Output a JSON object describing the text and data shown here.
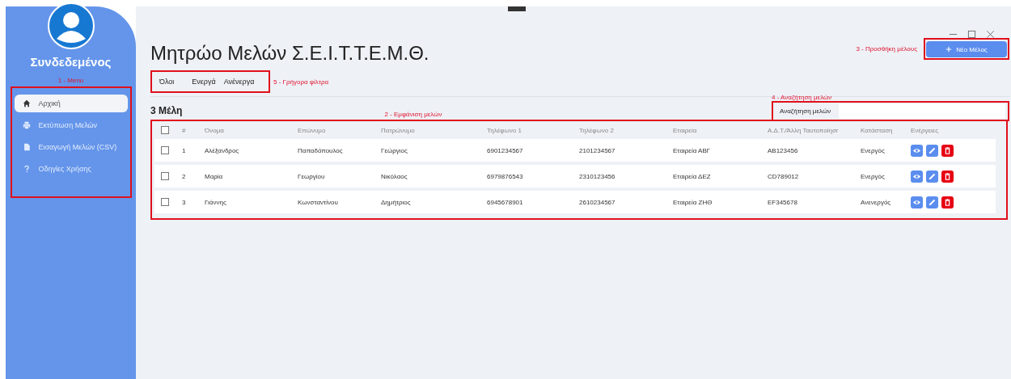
{
  "sidebar": {
    "user": "Συνδεδεμένος",
    "annotation": "1 - Menu",
    "items": [
      {
        "label": "Αρχική",
        "kind": "home",
        "selected": true
      },
      {
        "label": "Εκτύπωση Μελών",
        "kind": "print",
        "selected": false
      },
      {
        "label": "Εισαγωγή Μελών (CSV)",
        "kind": "import",
        "selected": false
      },
      {
        "label": "Οδηγίες Χρήσης",
        "kind": "help",
        "selected": false
      }
    ]
  },
  "title": "Μητρώο Μελών Σ.Ε.Ι.Τ.Τ.Ε.Μ.Θ.",
  "add_button": {
    "label": "Νέο Μέλος",
    "annotation": "3 - Προσθήκη μέλους"
  },
  "filters": {
    "annotation": "5 - Γρήγορα φίλτρα",
    "items": [
      {
        "label": "Όλοι"
      },
      {
        "label": "Ενεργά"
      },
      {
        "label": "Ανένεργα"
      }
    ]
  },
  "count": "3 Μέλη",
  "search": {
    "label": "Αναζήτηση μελών",
    "annotation": "4 - Αναζήτηση μελών"
  },
  "table": {
    "header_checked": false,
    "annotation": "2 - Εμφάνιση μελών",
    "columns": [
      "#",
      "Όνομα",
      "Επώνυμο",
      "Πατρώνυμο",
      "Τηλέφωνο 1",
      "Τηλέφωνο 2",
      "Εταιρεία",
      "Α.Δ.Τ./Άλλη Ταυτοποίησr",
      "Κατάσταση",
      "Ενέργειες"
    ],
    "rows": [
      {
        "checked": false,
        "cells": [
          "1",
          "Αλέξανδρος",
          "Παπαδόπουλος",
          "Γεώργιος",
          "6901234567",
          "2101234567",
          "Εταιρεία ΑΒΓ",
          "AB123456",
          "Ενεργός"
        ]
      },
      {
        "checked": false,
        "cells": [
          "2",
          "Μαρία",
          "Γεωργίου",
          "Νικόλαος",
          "6979876543",
          "2310123456",
          "Εταιρεία ΔΕΖ",
          "CD789012",
          "Ενεργός"
        ]
      },
      {
        "checked": false,
        "cells": [
          "3",
          "Γιάννης",
          "Κωνσταντίνου",
          "Δημήτριος",
          "6945678901",
          "2610234567",
          "Εταιρεία ΖΗΘ",
          "EF345678",
          "Ανενεργός"
        ]
      }
    ]
  }
}
